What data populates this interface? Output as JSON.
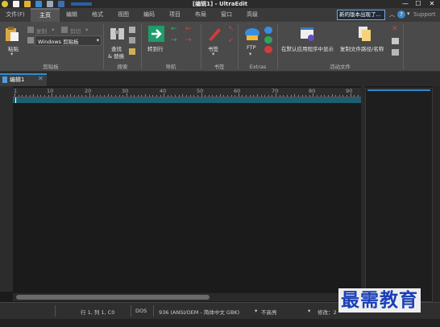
{
  "window": {
    "title": "[编辑1] - UltraEdit",
    "minimize_glyph": "—",
    "maximize_glyph": "☐",
    "close_glyph": "✕"
  },
  "menu": {
    "tabs": [
      "文件(F)",
      "主页",
      "编辑",
      "格式",
      "视图",
      "编码",
      "项目",
      "布局",
      "窗口",
      "高级"
    ],
    "active": "主页",
    "notice": "新的版本出现了...",
    "help_glyph": "?",
    "support": "Support"
  },
  "ribbon": {
    "clipboard": {
      "paste": "粘贴",
      "copy": "复制",
      "cut": "剪切",
      "clipboard_select": "Windows 剪贴板",
      "label": "剪贴板"
    },
    "search": {
      "find_replace_1": "查找",
      "find_replace_2": "& 替换",
      "label": "搜索"
    },
    "navigation": {
      "goto": "转到行",
      "label": "导航"
    },
    "bookmarks": {
      "bookmark": "书签",
      "label": "书签"
    },
    "extras": {
      "ftp": "FTP",
      "label": "Extras"
    },
    "active_file": {
      "show_default": "在默认应用程序中显示",
      "copy_path": "复制文件路径/名称",
      "label": "活动文件"
    }
  },
  "document": {
    "tab_label": "编辑1"
  },
  "ruler": {
    "numbers": [
      "1",
      "10",
      "20",
      "30",
      "40",
      "50",
      "60",
      "70",
      "80",
      "90"
    ]
  },
  "statusbar": {
    "position": "行 1, 列 1, C0",
    "line_ending": "DOS",
    "encoding": "936  (ANSI/OEM - 简体中文 GBK)",
    "highlight": "不高亮",
    "modified": "修改：2"
  },
  "watermark": "最需教育",
  "colors": {
    "accent": "#2e8bd2",
    "current_line": "#1f5d70",
    "editor_bg": "#1b1b1b",
    "ribbon_bg": "#4a4a4a"
  }
}
